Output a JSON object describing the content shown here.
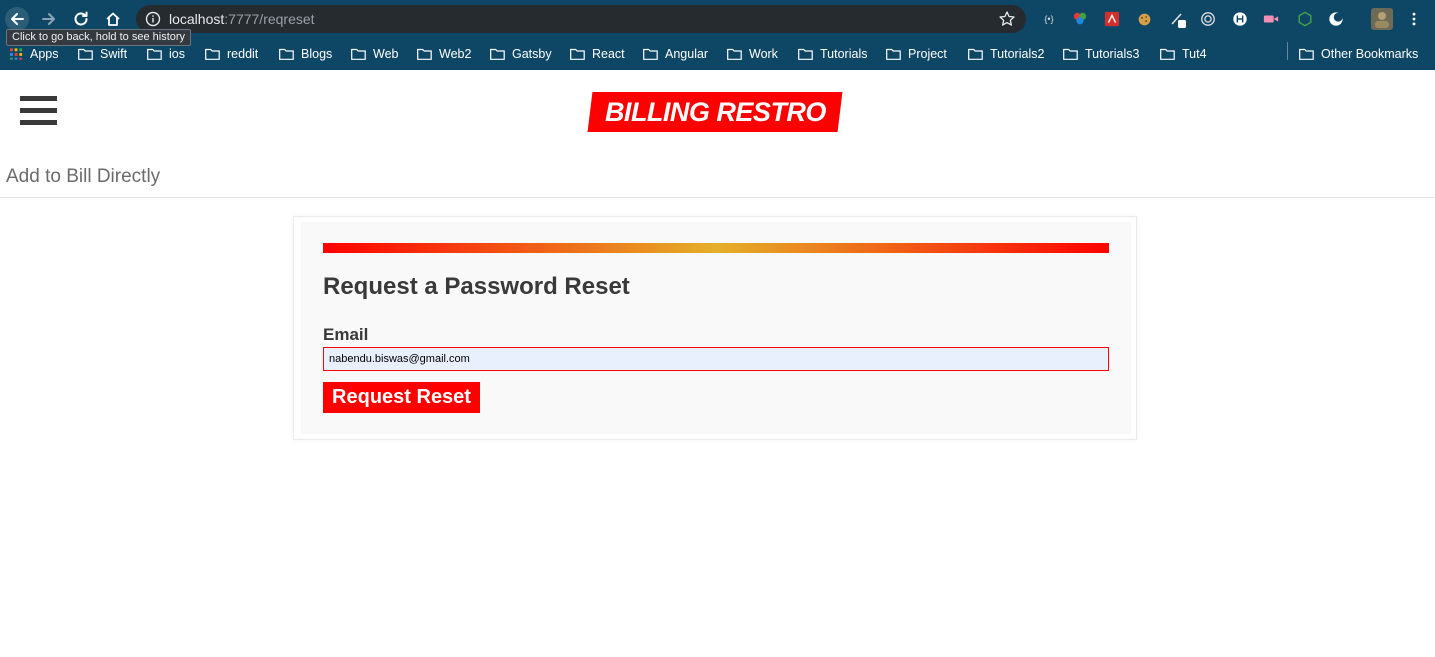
{
  "browser": {
    "url_host": "localhost",
    "url_path": ":7777/reqreset",
    "tooltip": "Click to go back, hold to see history",
    "bookmarks": [
      "Apps",
      "Swift",
      "ios",
      "reddit",
      "Blogs",
      "Web",
      "Web2",
      "Gatsby",
      "React",
      "Angular",
      "Work",
      "Tutorials",
      "Project",
      "Tutorials2",
      "Tutorials3",
      "Tut4"
    ],
    "other_bookmarks": "Other Bookmarks",
    "accent_color": "#0e4766"
  },
  "header": {
    "logo_text": "BILLING RESTRO",
    "brand_color": "#ff0000"
  },
  "subnav": {
    "link": "Add to Bill Directly"
  },
  "form": {
    "title": "Request a Password Reset",
    "email_label": "Email",
    "email_value": "nabendu.biswas@gmail.com",
    "submit_label": "Request Reset"
  }
}
